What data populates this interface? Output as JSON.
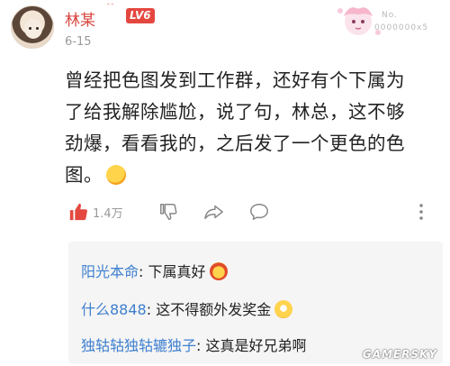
{
  "post": {
    "username": "林某",
    "sparkle": "ˇˇ",
    "level": "LV6",
    "date": "6-15",
    "decoration_text_1": "No.",
    "decoration_text_2": "0000000x5",
    "content_lines": [
      "曾经把色图发到工作群，还好有个下属为",
      "了给我解除尴尬，说了句，林总，这不够",
      "劲爆，看看我的，之后发了一个更色的色",
      "图。"
    ],
    "like_count": "1.4万"
  },
  "icons": {
    "like": "thumbs-up-icon",
    "dislike": "thumbs-down-icon",
    "share": "share-icon",
    "comment": "comment-icon",
    "more": "more-vertical-icon"
  },
  "colors": {
    "username": "#d8463f",
    "level_badge": "#e4473f",
    "reply_name": "#3e7fcf",
    "reply_bg": "#f5f5f5"
  },
  "replies": [
    {
      "name": "阳光本命",
      "sep": ": ",
      "text": "下属真好"
    },
    {
      "name": "什么8848",
      "sep": ": ",
      "text": "这不得额外发奖金"
    },
    {
      "name": "独轱轱独轱辘独子",
      "sep": ": ",
      "text": "这真是好兄弟啊"
    }
  ],
  "watermark": "GAMERSKY"
}
